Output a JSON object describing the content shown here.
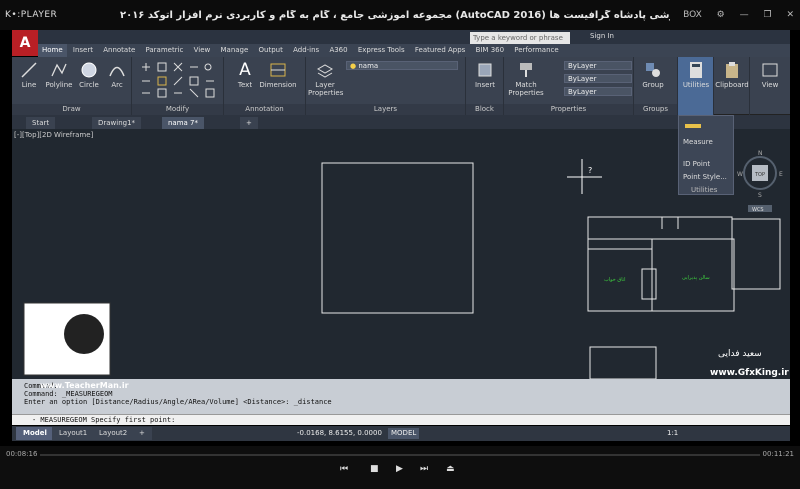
{
  "player": {
    "logo": "K•:PLAYER",
    "title": "مجموعه آموزشی جامع ، گام به گام و کاربردی نرم افزار  اتوکد ۲۰۱۶ (AutoCAD 2016)  مدرس : سعید فدایی ( تیچرمن ) گروه آموزشی پادشاه گرافیست ها",
    "controls": [
      "BOX",
      "⚙",
      "—",
      "❐",
      "✕"
    ]
  },
  "app": {
    "logo": "A",
    "search_placeholder": "Type a keyword or phrase",
    "signin": "Sign In"
  },
  "ribbon_tabs": [
    "Home",
    "Insert",
    "Annotate",
    "Parametric",
    "View",
    "Manage",
    "Output",
    "Add-ins",
    "A360",
    "Express Tools",
    "Featured Apps",
    "BIM 360",
    "Performance"
  ],
  "panels": {
    "draw": {
      "label": "Draw",
      "tools": [
        "Line",
        "Polyline",
        "Circle",
        "Arc"
      ]
    },
    "modify": {
      "label": "Modify"
    },
    "annotation": {
      "label": "Annotation",
      "tools": [
        "Text",
        "Dimension"
      ]
    },
    "layers": {
      "label": "Layers",
      "tool": "Layer Properties",
      "layer_name": "nama"
    },
    "block": {
      "label": "Block",
      "tool": "Insert"
    },
    "properties": {
      "label": "Properties",
      "tool": "Match Properties",
      "values": [
        "ByLayer",
        "ByLayer",
        "ByLayer"
      ]
    },
    "groups": {
      "label": "Groups",
      "tool": "Group"
    },
    "utilities": {
      "label": "Utilities"
    },
    "clipboard": {
      "label": "Clipboard"
    },
    "view": {
      "label": "View"
    }
  },
  "utilities_popup": {
    "measure": "Measure",
    "id_point": "ID Point",
    "point_style": "Point Style...",
    "label": "Utilities"
  },
  "doc_tabs": [
    "Start",
    "Drawing1*",
    "nama 7*",
    "+"
  ],
  "viewport_label": "[-][Top][2D Wireframe]",
  "viewcube": {
    "top": "TOP",
    "n": "N",
    "s": "S",
    "e": "E",
    "w": "W",
    "wcs": "WCS"
  },
  "drawing_labels": [
    "اتاق خواب",
    "سالن پذیرایی"
  ],
  "command": {
    "lines": [
      "Command:",
      "Command: _MEASUREGEOM",
      "Enter an option [Distance/Radius/Angle/ARea/Volume] <Distance>: _distance"
    ],
    "prompt": "- MEASUREGEOM Specify first point:"
  },
  "layout_tabs": [
    "Model",
    "Layout1",
    "Layout2",
    "+"
  ],
  "status": {
    "coords": "-0.0168, 8.6155, 0.0000",
    "model": "MODEL",
    "scale": "1:1"
  },
  "watermarks": {
    "site": "www.TeacherMan.ir",
    "gfx": "www.GfxKing.ir",
    "author": "سعید فدایی"
  },
  "timeline": {
    "current": "00:08:16",
    "total": "00:11:21"
  }
}
